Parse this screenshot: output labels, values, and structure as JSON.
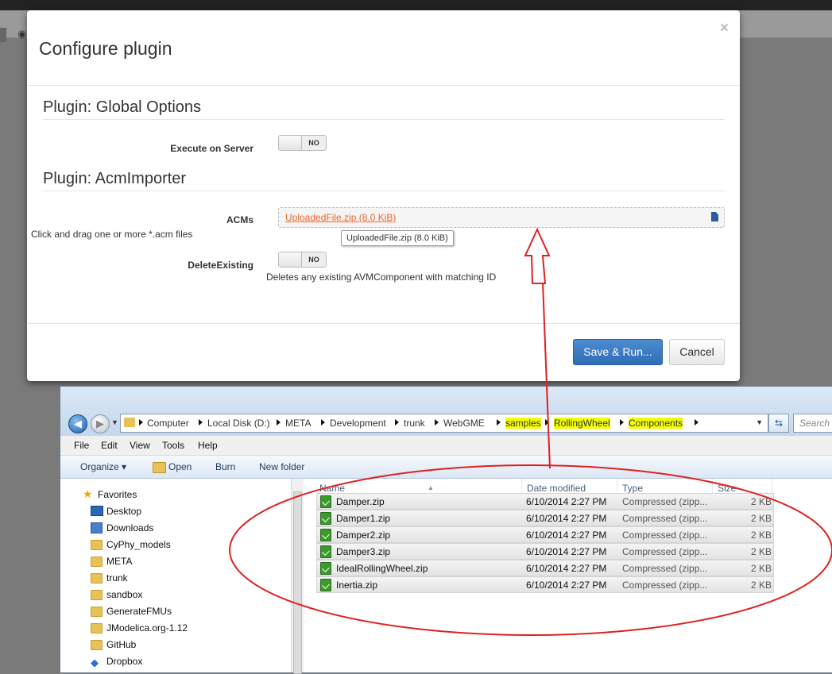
{
  "modal": {
    "title": "Configure plugin",
    "close_glyph": "×",
    "sections": [
      {
        "title": "Plugin: Global Options"
      },
      {
        "title": "Plugin: AcmImporter"
      }
    ],
    "fields": {
      "execute_on_server": {
        "label": "Execute on Server",
        "toggle": "NO"
      },
      "acms": {
        "label": "ACMs",
        "file_link": "UploadedFile.zip (8.0 KiB)",
        "help": "Click and drag one or more *.acm files",
        "tooltip": "UploadedFile.zip (8.0 KiB)"
      },
      "delete_existing": {
        "label": "DeleteExisting",
        "toggle": "NO",
        "help": "Deletes any existing AVMComponent with matching ID"
      }
    },
    "buttons": {
      "save_run": "Save & Run...",
      "cancel": "Cancel"
    }
  },
  "explorer": {
    "breadcrumbs": [
      "Computer",
      "Local Disk (D:)",
      "META",
      "Development",
      "trunk",
      "WebGME",
      "samples",
      "RollingWheel",
      "Components"
    ],
    "search_placeholder": "Search C",
    "menu": [
      "File",
      "Edit",
      "View",
      "Tools",
      "Help"
    ],
    "toolbar": {
      "organize": "Organize ▾",
      "open": "Open",
      "burn": "Burn",
      "new_folder": "New folder"
    },
    "favorites_label": "Favorites",
    "nav_items": [
      "Desktop",
      "Downloads",
      "CyPhy_models",
      "META",
      "trunk",
      "sandbox",
      "GenerateFMUs",
      "JModelica.org-1.12",
      "GitHub",
      "Dropbox"
    ],
    "columns": {
      "name": "Name",
      "date": "Date modified",
      "type": "Type",
      "size": "Size"
    },
    "files": [
      {
        "name": "Damper.zip",
        "date": "6/10/2014 2:27 PM",
        "type": "Compressed (zipp...",
        "size": "2 KB"
      },
      {
        "name": "Damper1.zip",
        "date": "6/10/2014 2:27 PM",
        "type": "Compressed (zipp...",
        "size": "2 KB"
      },
      {
        "name": "Damper2.zip",
        "date": "6/10/2014 2:27 PM",
        "type": "Compressed (zipp...",
        "size": "2 KB"
      },
      {
        "name": "Damper3.zip",
        "date": "6/10/2014 2:27 PM",
        "type": "Compressed (zipp...",
        "size": "2 KB"
      },
      {
        "name": "IdealRollingWheel.zip",
        "date": "6/10/2014 2:27 PM",
        "type": "Compressed (zipp...",
        "size": "2 KB"
      },
      {
        "name": "Inertia.zip",
        "date": "6/10/2014 2:27 PM",
        "type": "Compressed (zipp...",
        "size": "2 KB"
      }
    ]
  },
  "colors": {
    "annotation": "#e02020",
    "primary_button": "#3071b7",
    "file_link": "#f0632a",
    "highlight": "#f4ff00"
  }
}
